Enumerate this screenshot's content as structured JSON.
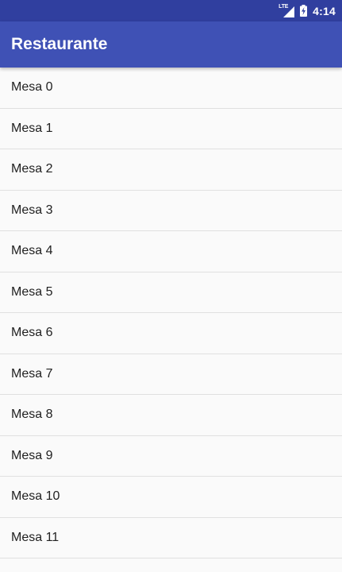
{
  "status_bar": {
    "network": "LTE",
    "time": "4:14"
  },
  "app_bar": {
    "title": "Restaurante",
    "background_color": "#3f51b5",
    "status_color": "#303f9f"
  },
  "tables": [
    {
      "label": "Mesa 0"
    },
    {
      "label": "Mesa 1"
    },
    {
      "label": "Mesa 2"
    },
    {
      "label": "Mesa 3"
    },
    {
      "label": "Mesa 4"
    },
    {
      "label": "Mesa 5"
    },
    {
      "label": "Mesa 6"
    },
    {
      "label": "Mesa 7"
    },
    {
      "label": "Mesa 8"
    },
    {
      "label": "Mesa 9"
    },
    {
      "label": "Mesa 10"
    },
    {
      "label": "Mesa 11"
    }
  ]
}
